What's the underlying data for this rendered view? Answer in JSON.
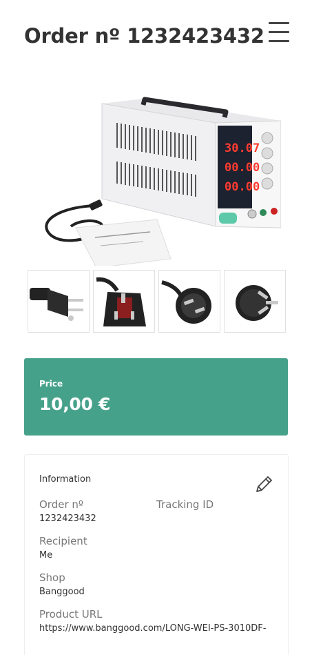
{
  "header": {
    "title": "Order nº 1232423432"
  },
  "icons": {
    "menu": "hamburger-menu-icon",
    "edit": "pencil-icon"
  },
  "product_images": {
    "main": "bench-power-supply-image",
    "thumbnails": [
      "us-plug-image",
      "uk-plug-image",
      "eu-plug-image",
      "au-plug-image"
    ]
  },
  "price": {
    "label": "Price",
    "value": "10,00 €"
  },
  "info": {
    "title": "Information",
    "order_no_label": "Order nº",
    "order_no_value": "1232423432",
    "tracking_label": "Tracking ID",
    "recipient_label": "Recipient",
    "recipient_value": "Me",
    "shop_label": "Shop",
    "shop_value": "Banggood",
    "url_label": "Product URL",
    "url_value": "https://www.banggood.com/LONG-WEI-PS-3010DF-"
  },
  "colors": {
    "accent": "#46a18a",
    "text": "#333333",
    "muted": "#777777"
  }
}
